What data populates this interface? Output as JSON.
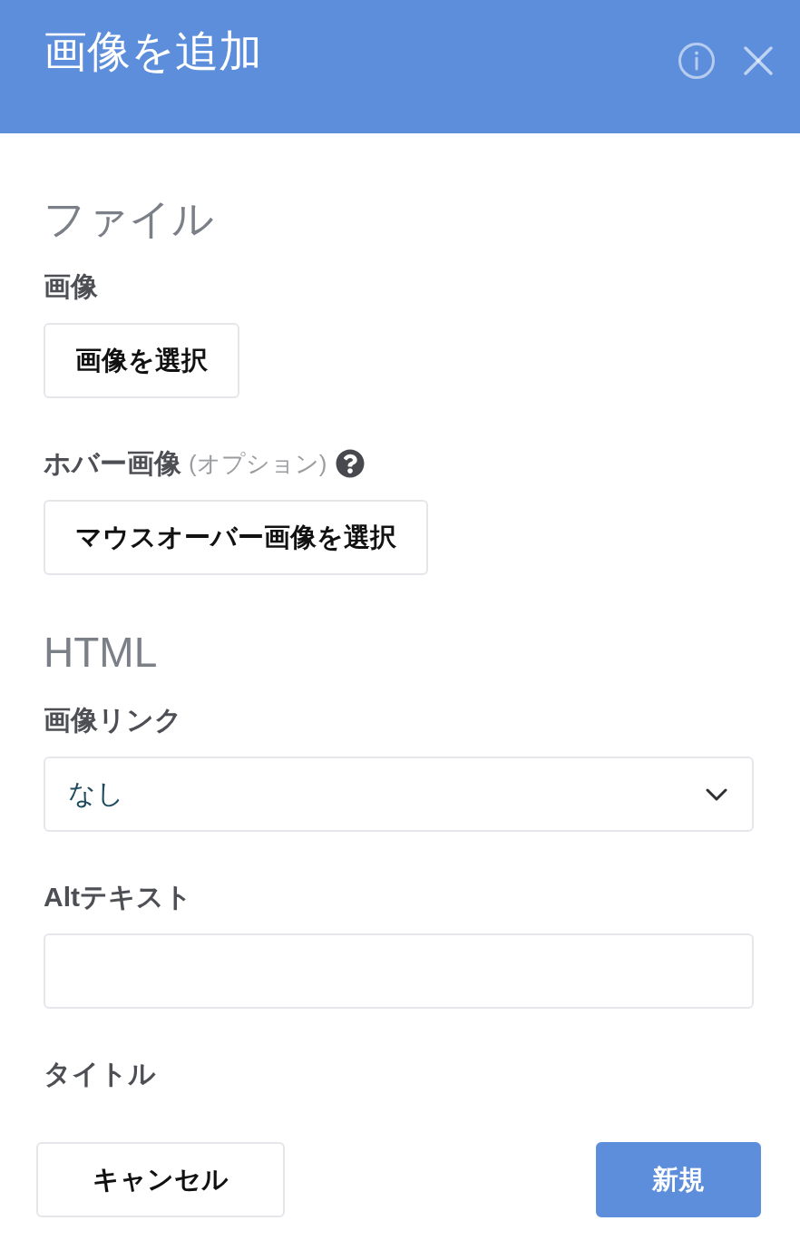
{
  "dialog": {
    "title": "画像を追加"
  },
  "sections": [
    {
      "heading": "ファイル",
      "fields": [
        {
          "kind": "file",
          "label": "画像",
          "help": false,
          "button": "画像を選択"
        },
        {
          "kind": "file",
          "label": "ホバー画像",
          "note": "(オプション)",
          "help": true,
          "button": "マウスオーバー画像を選択"
        }
      ]
    },
    {
      "heading": "HTML",
      "fields": [
        {
          "kind": "select",
          "label": "画像リンク",
          "help": false,
          "value": "なし"
        },
        {
          "kind": "text",
          "label": "Altテキスト",
          "help": false
        },
        {
          "kind": "label",
          "label": "タイトル",
          "help": false
        }
      ]
    }
  ],
  "footer": {
    "buttons": [
      {
        "kind": "secondary",
        "label": "キャンセル"
      },
      {
        "kind": "primary",
        "label": "新規"
      }
    ]
  }
}
